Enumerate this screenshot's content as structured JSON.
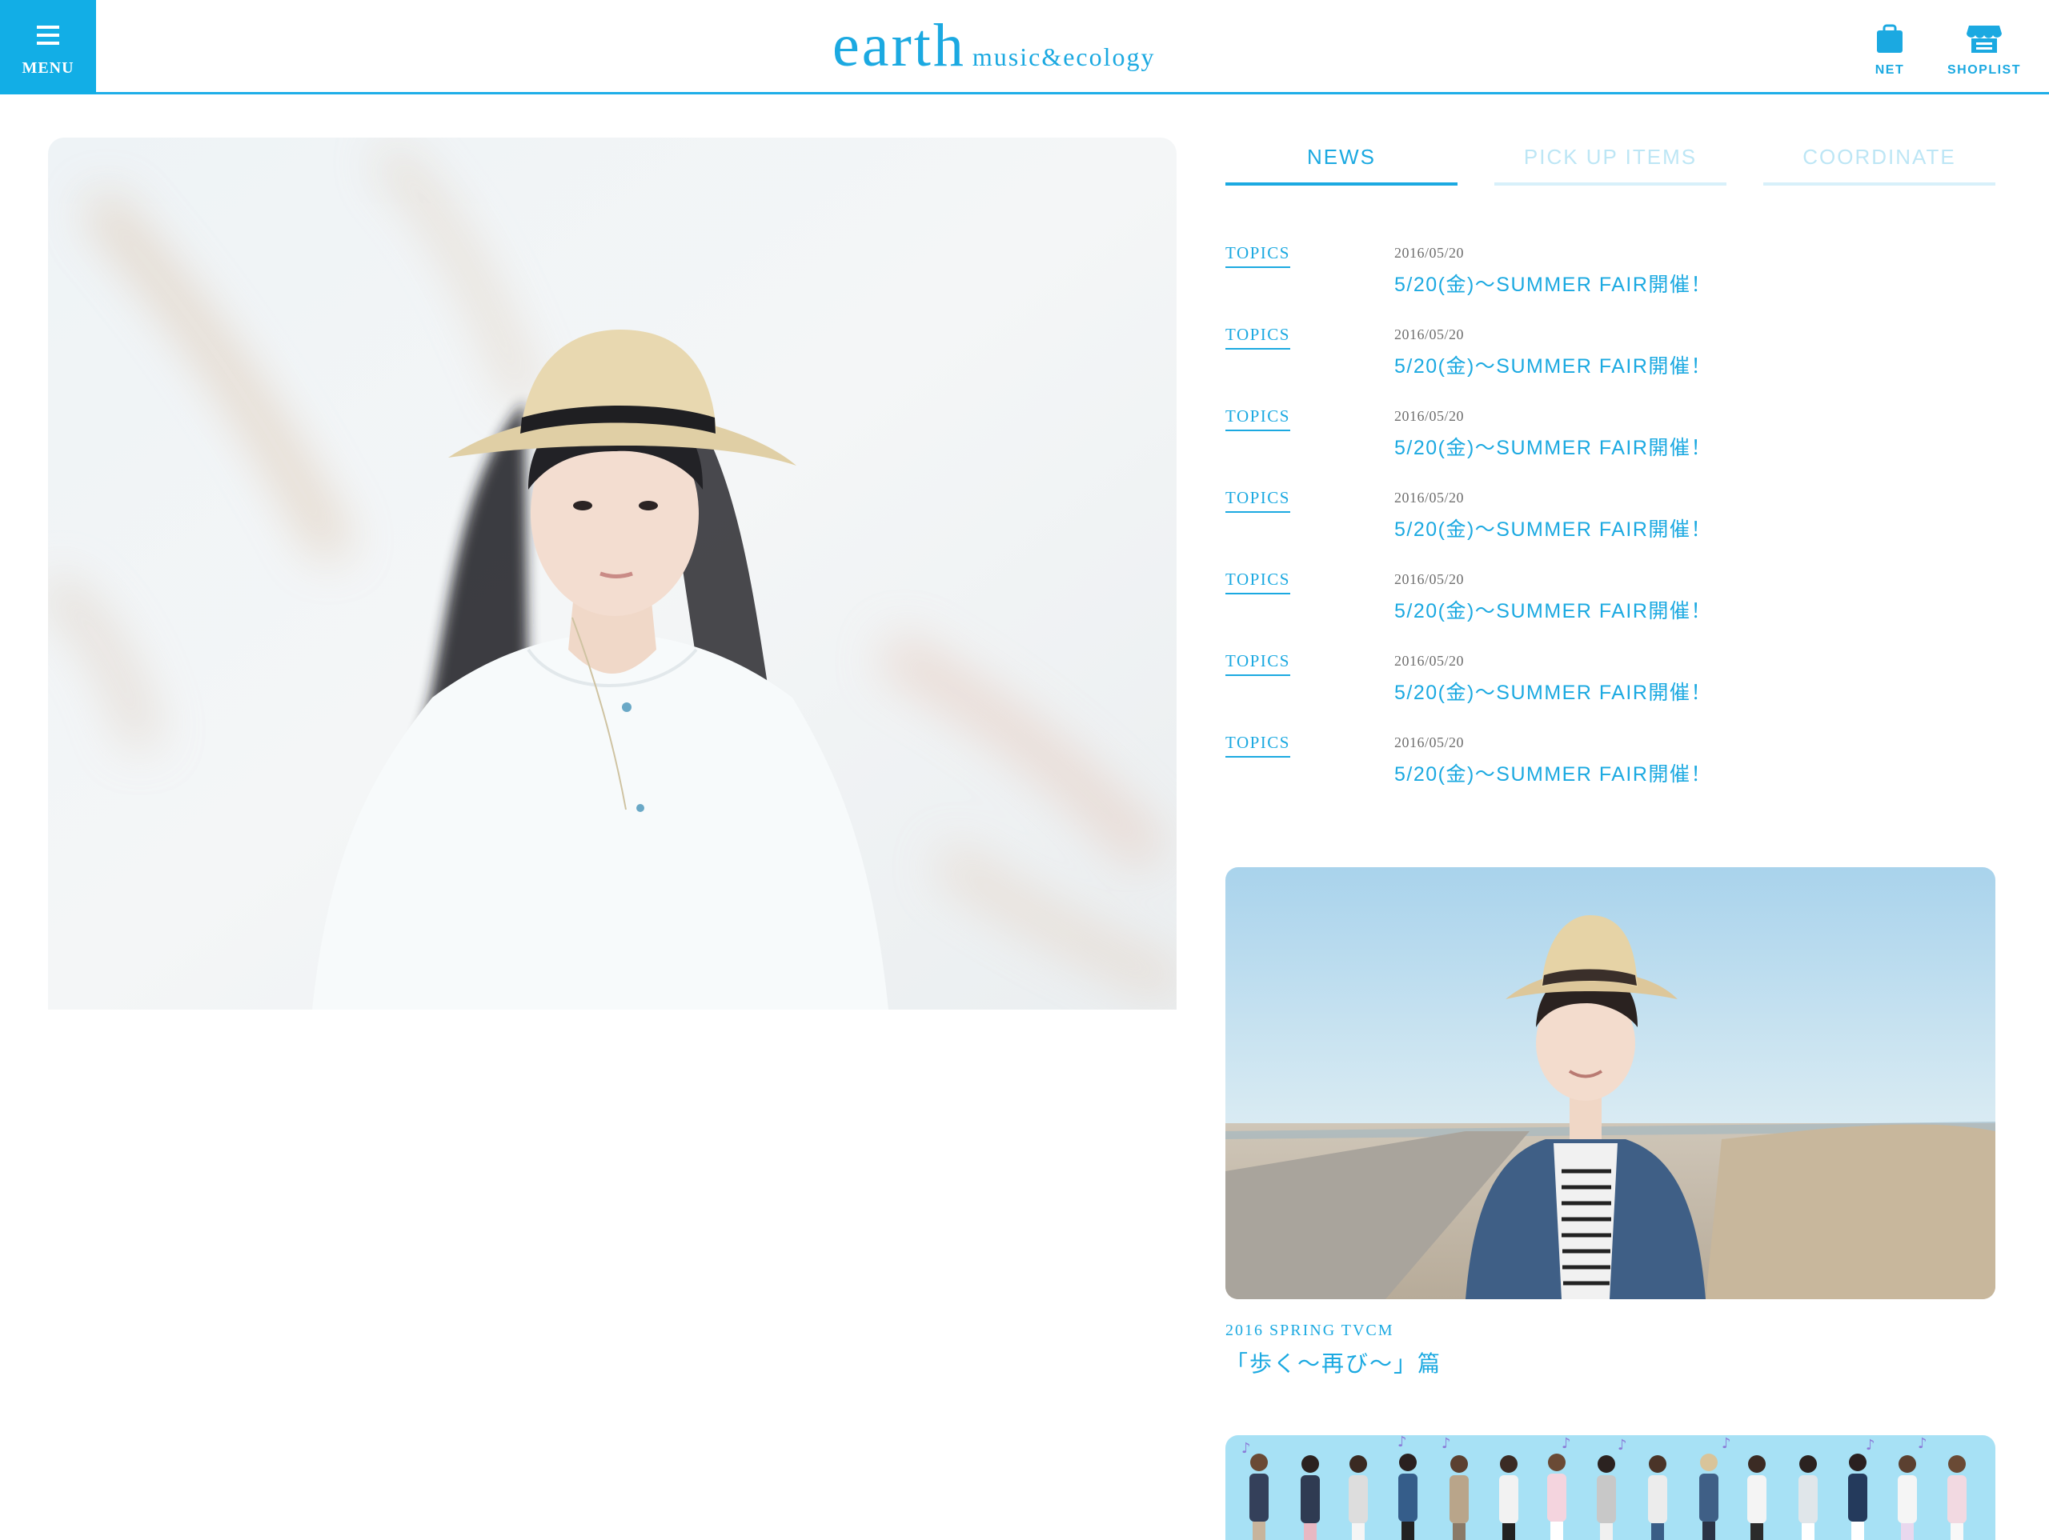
{
  "colors": {
    "accent": "#1ba9e1",
    "accent_light": "#bde6f5",
    "menu_bg": "#12aee6",
    "date_text": "#6f6f6f"
  },
  "header": {
    "menu_label": "MENU",
    "menu_icon": "hamburger-icon",
    "logo_main": "earth",
    "logo_sub": "music&ecology",
    "net_label": "NET",
    "net_icon": "shopping-bag-icon",
    "shoplist_label": "SHOPLIST",
    "shoplist_icon": "store-icon"
  },
  "tabs": [
    {
      "label": "NEWS",
      "active": true
    },
    {
      "label": "PICK UP ITEMS",
      "active": false
    },
    {
      "label": "COORDINATE",
      "active": false
    }
  ],
  "news": [
    {
      "category": "TOPICS",
      "date": "2016/05/20",
      "title": "5/20(金)〜SUMMER FAIR開催！"
    },
    {
      "category": "TOPICS",
      "date": "2016/05/20",
      "title": "5/20(金)〜SUMMER FAIR開催！"
    },
    {
      "category": "TOPICS",
      "date": "2016/05/20",
      "title": "5/20(金)〜SUMMER FAIR開催！"
    },
    {
      "category": "TOPICS",
      "date": "2016/05/20",
      "title": "5/20(金)〜SUMMER FAIR開催！"
    },
    {
      "category": "TOPICS",
      "date": "2016/05/20",
      "title": "5/20(金)〜SUMMER FAIR開催！"
    },
    {
      "category": "TOPICS",
      "date": "2016/05/20",
      "title": "5/20(金)〜SUMMER FAIR開催！"
    },
    {
      "category": "TOPICS",
      "date": "2016/05/20",
      "title": "5/20(金)〜SUMMER FAIR開催！"
    }
  ],
  "tvcm": {
    "caption": "2016 SPRING TVCM",
    "title": "「歩く〜再び〜」篇"
  }
}
